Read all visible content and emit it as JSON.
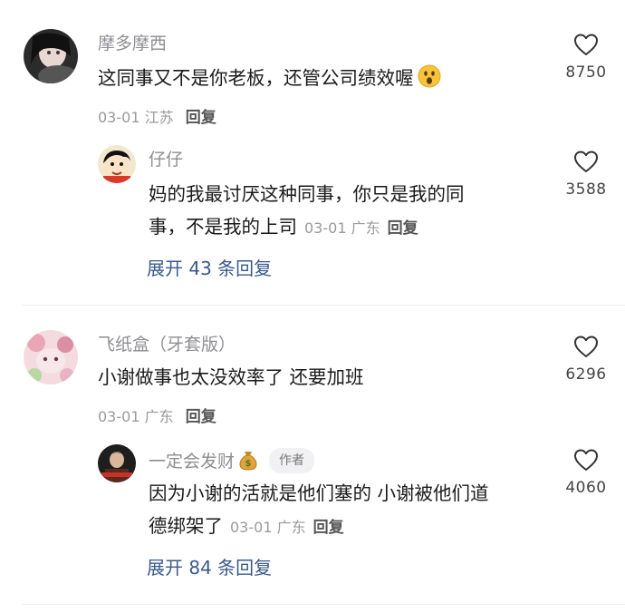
{
  "comments": [
    {
      "username": "摩多摩西",
      "text": "这同事又不是你老板，还管公司绩效喔",
      "date": "03-01",
      "location": "江苏",
      "reply_label": "回复",
      "like_count": "8750",
      "replies": [
        {
          "username": "仔仔",
          "text_line1": "妈的我最讨厌这种同事，你只是我的同",
          "text_line2": "事，不是我的上司",
          "date": "03-01",
          "location": "广东",
          "reply_label": "回复",
          "like_count": "3588"
        }
      ],
      "expand_label": "展开 43 条回复"
    },
    {
      "username": "飞纸盒（牙套版）",
      "text": "小谢做事也太没效率了 还要加班",
      "date": "03-01",
      "location": "广东",
      "reply_label": "回复",
      "like_count": "6296",
      "replies": [
        {
          "username": "一定会发财",
          "author_badge": "作者",
          "text_line1": "因为小谢的活就是他们塞的 小谢被他们道",
          "text_line2": "德绑架了",
          "date": "03-01",
          "location": "广东",
          "reply_label": "回复",
          "like_count": "4060"
        }
      ],
      "expand_label": "展开 84 条回复"
    }
  ],
  "icons": {
    "like": "heart-outline-icon",
    "emoji_surprised": "surprised-face-emoji",
    "emoji_money_bag": "money-bag-emoji"
  },
  "colors": {
    "username": "#8e8e93",
    "expand_link": "#3a5a8c",
    "meta": "#9a9a9f"
  }
}
